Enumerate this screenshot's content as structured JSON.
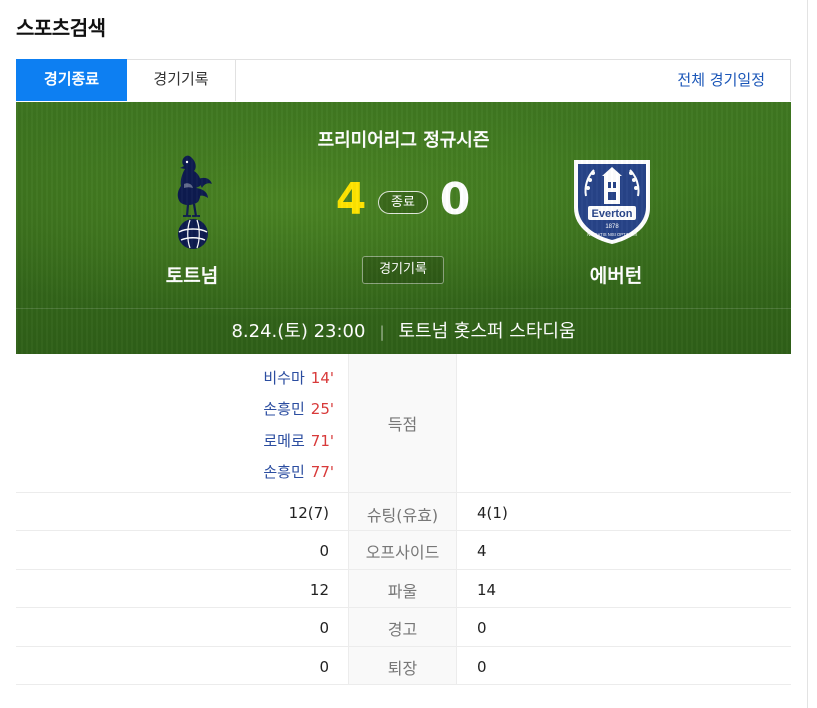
{
  "page": {
    "title": "스포츠검색"
  },
  "tabs": {
    "active": "경기종료",
    "record": "경기기록",
    "schedule_link": "전체 경기일정"
  },
  "match": {
    "league": "프리미어리그 정규시즌",
    "home": {
      "name": "토트넘",
      "score": "4",
      "logo_icon": "tottenham-logo-icon"
    },
    "away": {
      "name": "에버턴",
      "score": "0",
      "logo_icon": "everton-logo-icon",
      "crest_text": "Everton",
      "crest_year": "1878",
      "crest_motto": "NIL SATIS NISI OPTIMUM"
    },
    "status": "종료",
    "record_button": "경기기록",
    "datetime": "8.24.(토) 23:00",
    "stadium": "토트넘 홋스퍼 스타디움"
  },
  "goals": {
    "label": "득점",
    "home": [
      {
        "player": "비수마",
        "minute": "14'"
      },
      {
        "player": "손흥민",
        "minute": "25'"
      },
      {
        "player": "로메로",
        "minute": "71'"
      },
      {
        "player": "손흥민",
        "minute": "77'"
      }
    ]
  },
  "stats": [
    {
      "label": "슈팅(유효)",
      "home": "12(7)",
      "away": "4(1)"
    },
    {
      "label": "오프사이드",
      "home": "0",
      "away": "4"
    },
    {
      "label": "파울",
      "home": "12",
      "away": "14"
    },
    {
      "label": "경고",
      "home": "0",
      "away": "0"
    },
    {
      "label": "퇴장",
      "home": "0",
      "away": "0"
    }
  ],
  "colors": {
    "accent_blue": "#0d7ff2",
    "score_yellow": "#ffe400",
    "player_blue": "#2b4da0",
    "minute_red": "#d83a3a",
    "everton_blue": "#274488",
    "spurs_navy": "#132257"
  }
}
